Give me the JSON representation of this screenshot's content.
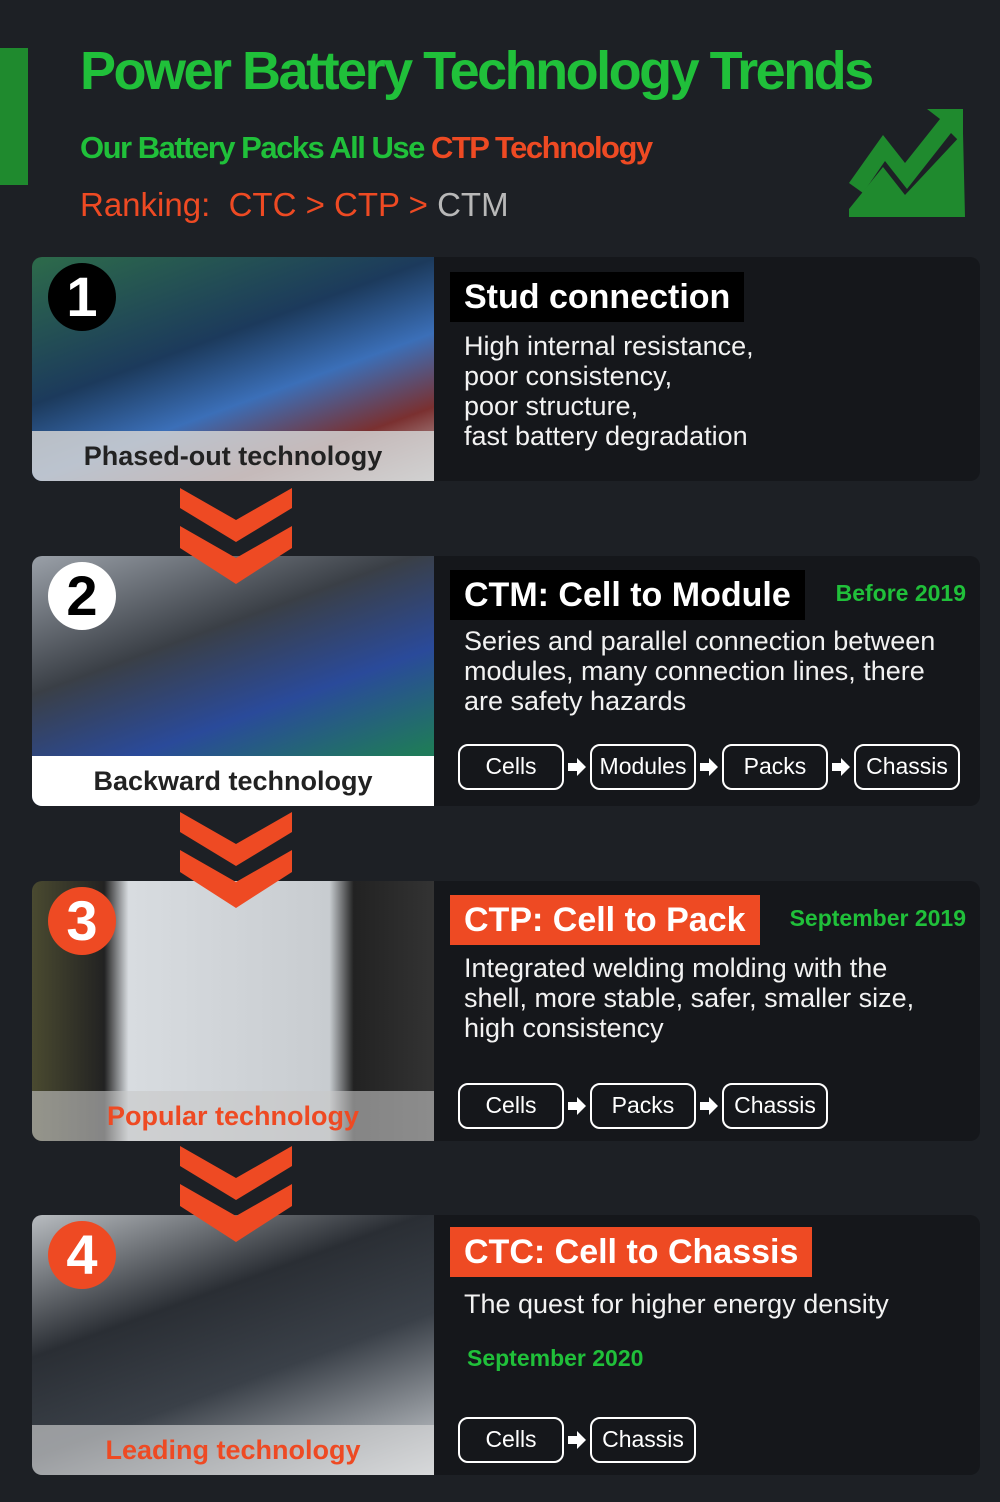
{
  "header": {
    "title": "Power Battery Technology Trends",
    "subtitle_prefix": "Our Battery Packs All Use ",
    "subtitle_highlight": "CTP Technology",
    "ranking_label": "Ranking:",
    "ranking_ctc": "CTC",
    "sep": ">",
    "ranking_ctp": "CTP",
    "ranking_ctm": "CTM",
    "icon": "trend-up-chart-icon"
  },
  "colors": {
    "green": "#20c03a",
    "orange": "#ee4a23",
    "background": "#1d2025"
  },
  "stages": [
    {
      "number": "1",
      "caption": "Phased-out technology",
      "heading": "Stud connection",
      "date": "",
      "desc": [
        "High internal resistance,",
        "poor consistency,",
        "poor structure,",
        "fast battery degradation"
      ],
      "flow": []
    },
    {
      "number": "2",
      "caption": "Backward technology",
      "heading": "CTM: Cell to Module",
      "date": "Before 2019",
      "desc": [
        "Series and parallel connection between",
        "modules, many connection lines, there",
        "are safety hazards"
      ],
      "flow": [
        "Cells",
        "Modules",
        "Packs",
        "Chassis"
      ]
    },
    {
      "number": "3",
      "caption": "Popular technology",
      "heading": "CTP: Cell to Pack",
      "date": "September 2019",
      "desc": [
        "Integrated welding molding with the",
        "shell, more stable, safer, smaller size,",
        "high consistency"
      ],
      "flow": [
        "Cells",
        "Packs",
        "Chassis"
      ]
    },
    {
      "number": "4",
      "caption": "Leading technology",
      "heading": "CTC: Cell to Chassis",
      "date": "September 2020",
      "desc": [
        "The quest for higher energy density"
      ],
      "flow": [
        "Cells",
        "Chassis"
      ]
    }
  ]
}
